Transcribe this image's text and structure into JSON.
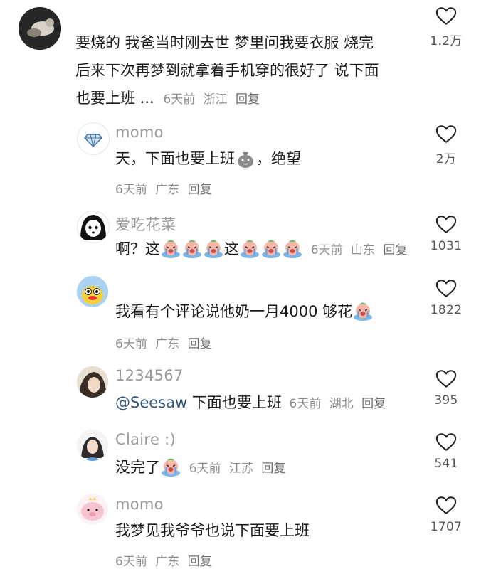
{
  "comments": [
    {
      "username": "",
      "lines": [
        "要烧的 我爸当时刚去世 梦里问我要衣服 烧完",
        "后来下次再梦到就拿着手机穿的很好了 说下面",
        "也要上班 ..."
      ],
      "time": "6天前",
      "location": "浙江",
      "reply": "回复",
      "likes": "1.2万"
    },
    {
      "username": "momo",
      "text_a": "天，下面也要上班",
      "text_b": "，绝望",
      "time": "6天前",
      "location": "广东",
      "reply": "回复",
      "likes": "2万"
    },
    {
      "username": "爱吃花菜",
      "text_a": "啊？这",
      "text_b": "这",
      "time": "6天前",
      "location": "山东",
      "reply": "回复",
      "likes": "1031"
    },
    {
      "username": "",
      "text": "我看有个评论说他奶一月4000 够花",
      "time": "6天前",
      "location": "广东",
      "reply": "回复",
      "likes": "1822"
    },
    {
      "username": "1234567",
      "mention": "@Seesaw",
      "text": " 下面也要上班",
      "time": "6天前",
      "location": "湖北",
      "reply": "回复",
      "likes": "395"
    },
    {
      "username": "Claire :)",
      "text": "没完了",
      "time": "6天前",
      "location": "江苏",
      "reply": "回复",
      "likes": "541"
    },
    {
      "username": "momo",
      "text": "我梦见我爷爷也说下面要上班",
      "time": "6天前",
      "location": "广东",
      "reply": "回复",
      "likes": "1707"
    }
  ],
  "icons": {
    "like": "heart-outline-icon",
    "emoji_money": "money-bag-emoji",
    "emoji_crying": "crying-face-emoji"
  },
  "colors": {
    "username": "#9a9a9a",
    "meta": "#8e8e8e",
    "mention": "#33557a"
  }
}
